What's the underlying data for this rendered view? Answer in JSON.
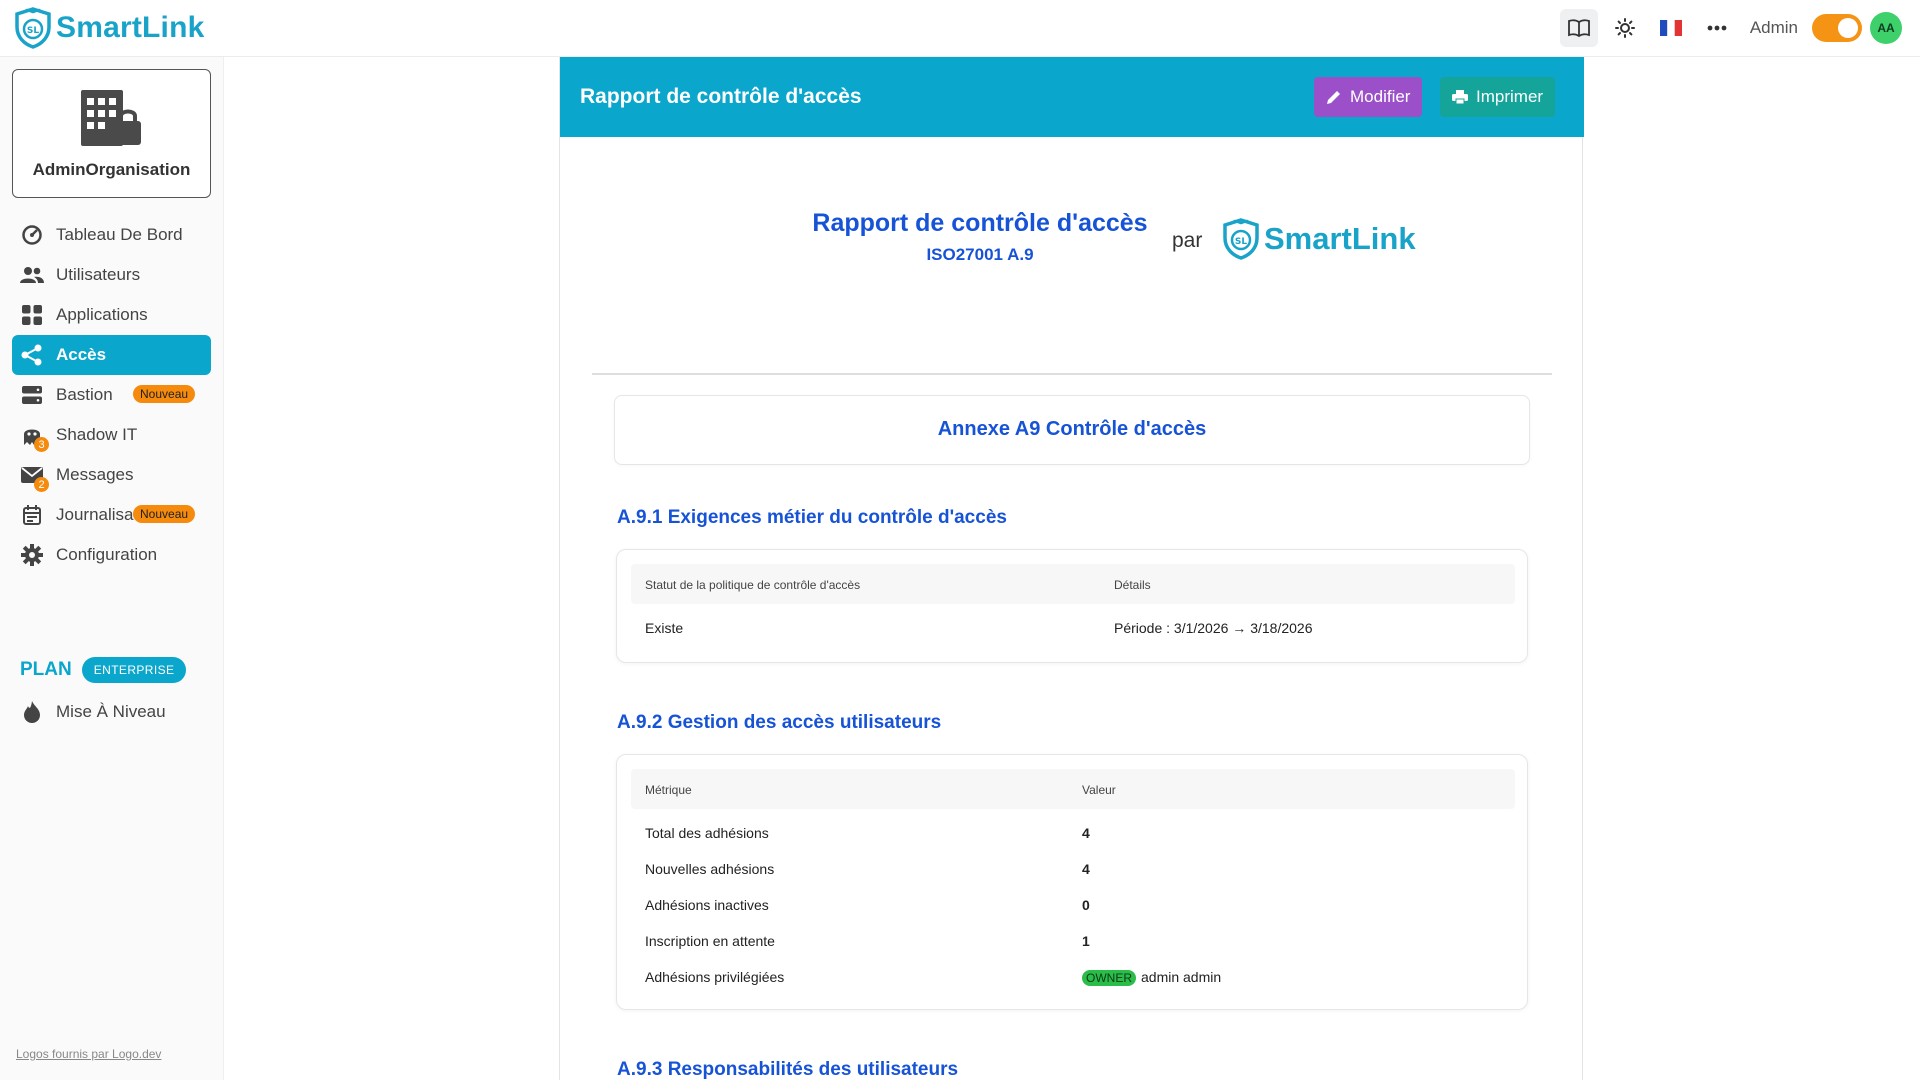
{
  "app": {
    "brand": "SmartLink",
    "admin_label": "Admin",
    "avatar_initials": "AA",
    "accent": "#0aa6cc",
    "toolbar_icons": [
      "book-icon",
      "sun-icon",
      "flag-fr-icon",
      "more-icon"
    ]
  },
  "sidebar": {
    "org_name": "AdminOrganisation",
    "items": [
      {
        "label": "Tableau De Bord",
        "icon": "dashboard-icon"
      },
      {
        "label": "Utilisateurs",
        "icon": "users-icon"
      },
      {
        "label": "Applications",
        "icon": "apps-icon"
      },
      {
        "label": "Accès",
        "icon": "share-icon",
        "active": true
      },
      {
        "label": "Bastion",
        "icon": "server-icon",
        "badge": "Nouveau"
      },
      {
        "label": "Shadow IT",
        "icon": "ghost-icon",
        "count": "3"
      },
      {
        "label": "Messages",
        "icon": "mail-icon",
        "count": "2"
      },
      {
        "label": "Journalisation",
        "icon": "calendar-icon",
        "badge": "Nouveau"
      },
      {
        "label": "Configuration",
        "icon": "gear-icon"
      }
    ],
    "plan_label": "PLAN",
    "plan_badge": "ENTERPRISE",
    "upgrade_label": "Mise À Niveau",
    "footer_link": "Logos fournis par Logo.dev"
  },
  "report": {
    "header_title": "Rapport de contrôle d'accès",
    "edit_label": "Modifier",
    "print_label": "Imprimer",
    "hero_title": "Rapport de contrôle d'accès",
    "hero_subtitle": "ISO27001 A.9",
    "hero_par": "par",
    "annex_title": "Annexe A9 Contrôle d'accès",
    "sections": [
      {
        "title": "A.9.1 Exigences métier du contrôle d'accès",
        "headers": [
          "Statut de la politique de contrôle d'accès",
          "Détails"
        ],
        "rows": [
          [
            "Existe",
            "Période : 3/1/2026 → 3/18/2026"
          ]
        ]
      },
      {
        "title": "A.9.2 Gestion des accès utilisateurs",
        "headers": [
          "Métrique",
          "Valeur"
        ],
        "rows": [
          [
            "Total des adhésions",
            "4"
          ],
          [
            "Nouvelles adhésions",
            "4"
          ],
          [
            "Adhésions inactives",
            "0"
          ],
          [
            "Inscription en attente",
            "1"
          ],
          [
            "Adhésions privilégiées",
            "admin admin"
          ]
        ],
        "owner_tag": "OWNER"
      },
      {
        "title": "A.9.3 Responsabilités des utilisateurs"
      }
    ]
  }
}
